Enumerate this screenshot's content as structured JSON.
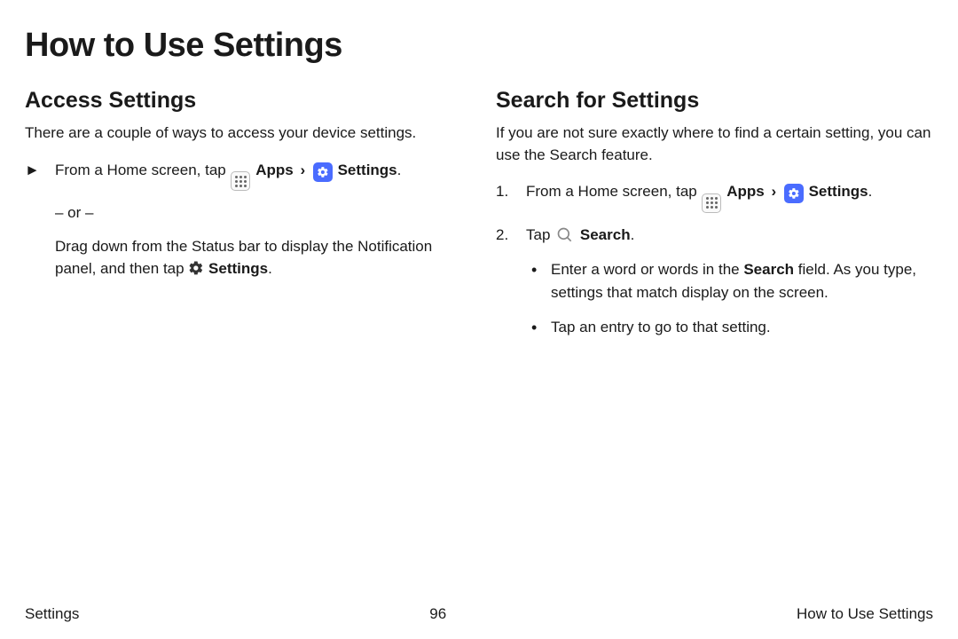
{
  "page_title": "How to Use Settings",
  "left": {
    "heading": "Access Settings",
    "intro": "There are a couple of ways to access your device settings.",
    "step1_prefix": "From a Home screen, tap ",
    "apps_label": "Apps",
    "separator": "›",
    "settings_label": "Settings",
    "or_text": "– or –",
    "step1_alt_prefix": "Drag down from the Status bar to display the Notification panel, and then tap ",
    "settings_label2": "Settings"
  },
  "right": {
    "heading": "Search for Settings",
    "intro": "If you are not sure exactly where to find a certain setting, you can use the Search feature.",
    "step1_prefix": "From a Home screen, tap ",
    "apps_label": "Apps",
    "separator": "›",
    "settings_label": "Settings",
    "step2_prefix": "Tap ",
    "search_label": "Search",
    "bullet1_a": "Enter a word or words in the ",
    "bullet1_bold": "Search",
    "bullet1_b": " field. As you type, settings that match display on the screen.",
    "bullet2": "Tap an entry to go to that setting."
  },
  "footer": {
    "left": "Settings",
    "center": "96",
    "right": "How to Use Settings"
  }
}
